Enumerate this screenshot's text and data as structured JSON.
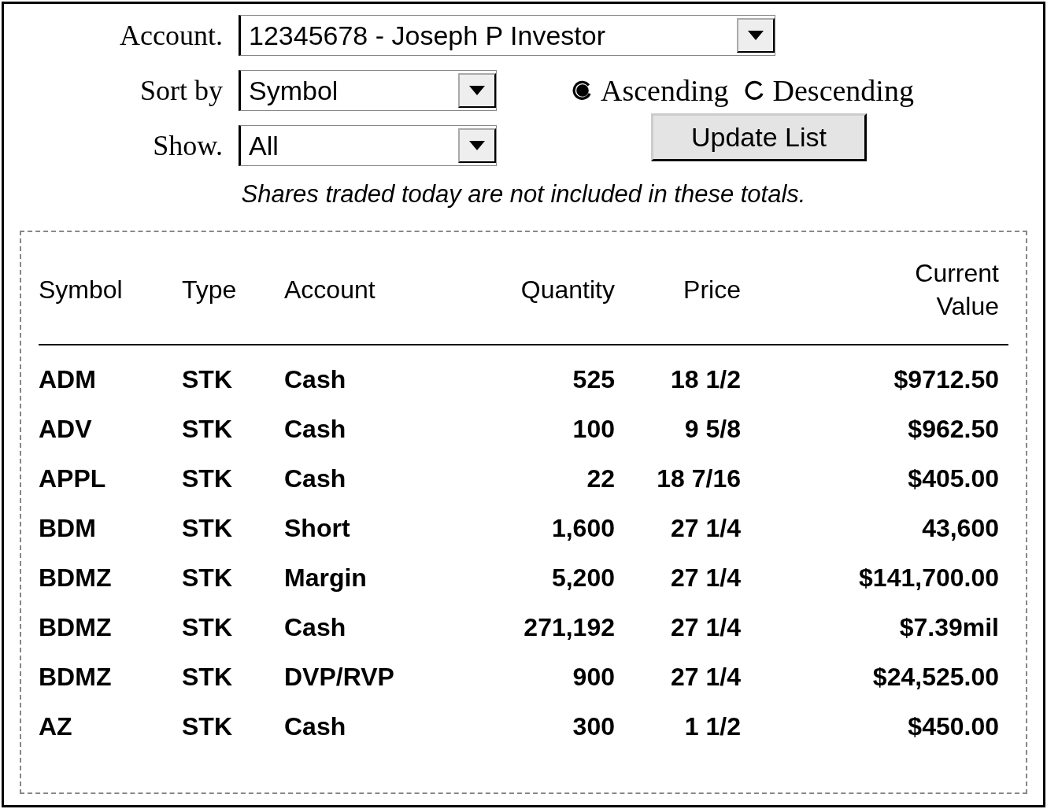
{
  "account": {
    "label": "Account.",
    "value": "12345678 - Joseph P Investor"
  },
  "sort_by": {
    "label": "Sort by",
    "value": "Symbol"
  },
  "show": {
    "label": "Show.",
    "value": "All"
  },
  "sort_order": [
    {
      "label": "Ascending",
      "selected": true
    },
    {
      "label": "Descending",
      "selected": false
    }
  ],
  "update_button": "Update List",
  "note": "Shares traded today are not included in these totals.",
  "table": {
    "columns": [
      "Symbol",
      "Type",
      "Account",
      "Quantity",
      "Price",
      "Current Value"
    ],
    "rows": [
      [
        "ADM",
        "STK",
        "Cash",
        "525",
        "18 1/2",
        "$9712.50"
      ],
      [
        "ADV",
        "STK",
        "Cash",
        "100",
        "9 5/8",
        "$962.50"
      ],
      [
        "APPL",
        "STK",
        "Cash",
        "22",
        "18 7/16",
        "$405.00"
      ],
      [
        "BDM",
        "STK",
        "Short",
        "1,600",
        "27 1/4",
        "43,600"
      ],
      [
        "BDMZ",
        "STK",
        "Margin",
        "5,200",
        "27 1/4",
        "$141,700.00"
      ],
      [
        "BDMZ",
        "STK",
        "Cash",
        "271,192",
        "27 1/4",
        "$7.39mil"
      ],
      [
        "BDMZ",
        "STK",
        "DVP/RVP",
        "900",
        "27 1/4",
        "$24,525.00"
      ],
      [
        "AZ",
        "STK",
        "Cash",
        "300",
        "1 1/2",
        "$450.00"
      ]
    ]
  }
}
